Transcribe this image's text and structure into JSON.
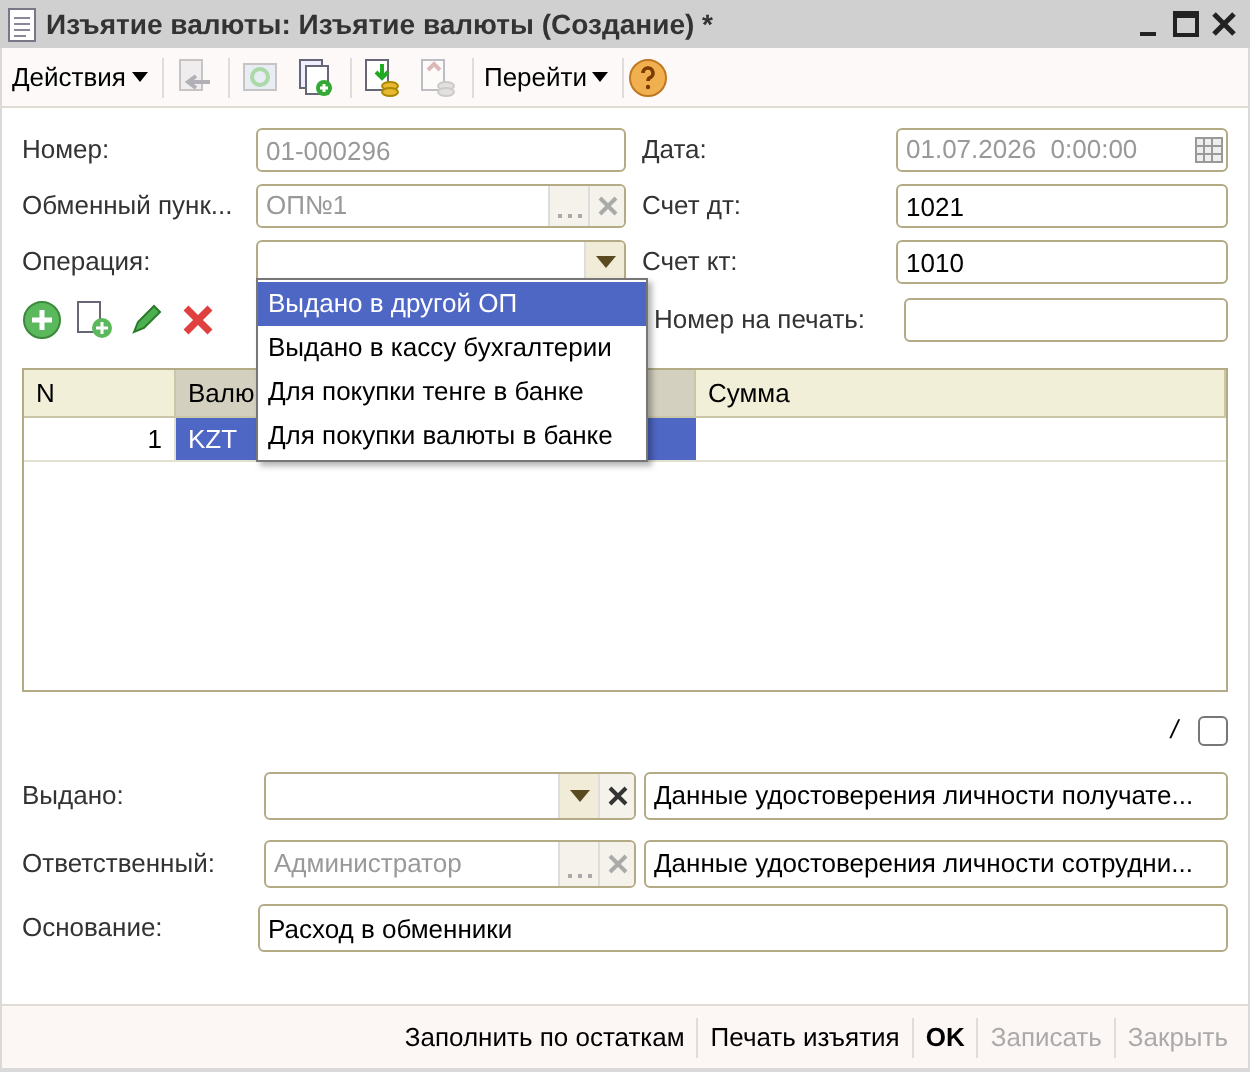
{
  "window": {
    "title": "Изъятие валюты: Изъятие валюты (Создание) *"
  },
  "toolbar": [
    {
      "kind": "menu",
      "label": "Действия"
    },
    {
      "kind": "icon",
      "disabled": true
    },
    {
      "kind": "icon",
      "disabled": true
    },
    {
      "kind": "icon",
      "disabled": false
    },
    {
      "kind": "icon",
      "disabled": false
    },
    {
      "kind": "icon",
      "disabled": true
    },
    {
      "kind": "menu",
      "label": "Перейти"
    },
    {
      "kind": "help",
      "disabled": false
    }
  ],
  "form": {
    "number": {
      "label": "Номер:",
      "value": "01-000296",
      "disabled": true
    },
    "date": {
      "label": "Дата:",
      "value": "01.07.2026  0:00:00",
      "disabled": true
    },
    "exchange_point": {
      "label": "Обменный пунк...",
      "value": "ОП№1",
      "disabled": true
    },
    "debit_account": {
      "label": "Счет дт:",
      "value": "1021"
    },
    "operation": {
      "label": "Операция:",
      "expanded": true,
      "options": [
        {
          "label": "Выдано в другой ОП",
          "selected": true
        },
        {
          "label": "Выдано в кассу бухгалтерии",
          "selected": false
        },
        {
          "label": "Для покупки тенге в банке",
          "selected": false
        },
        {
          "label": "Для покупки валюты в банке",
          "selected": false
        }
      ]
    },
    "credit_account": {
      "label": "Счет кт:",
      "value": "1010"
    },
    "print_number": {
      "label": "Номер на печать:"
    }
  },
  "table": {
    "columns": [
      "N",
      "Валю",
      "Сумма"
    ],
    "rows": [
      {
        "cells": [
          "1",
          "KZT",
          ""
        ],
        "selected": true
      }
    ]
  },
  "checkbox": {
    "label": "/",
    "checked": false
  },
  "issued": {
    "label": "Выдано:",
    "details": "Данные удостоверения личности получате..."
  },
  "responsible": {
    "label": "Ответственный:",
    "value": "Администратор",
    "disabled": true,
    "details": "Данные удостоверения личности сотрудни..."
  },
  "basis": {
    "label": "Основание:",
    "value": "Расход в обменники"
  },
  "buttons": [
    {
      "label": "Заполнить по остаткам",
      "default": false,
      "disabled": false
    },
    {
      "label": "Печать изъятия",
      "default": false,
      "disabled": false
    },
    {
      "label": "OK",
      "default": true,
      "disabled": false
    },
    {
      "label": "Записать",
      "default": false,
      "disabled": true
    },
    {
      "label": "Закрыть",
      "default": false,
      "disabled": true
    }
  ]
}
